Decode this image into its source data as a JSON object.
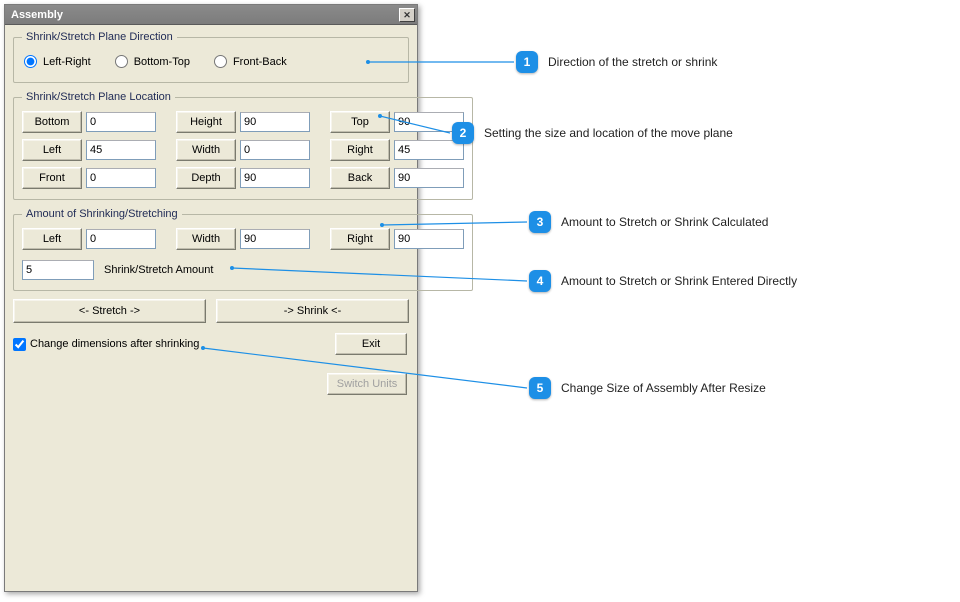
{
  "title": "Assembly",
  "direction": {
    "legend": "Shrink/Stretch Plane Direction",
    "options": {
      "lr": "Left-Right",
      "bt": "Bottom-Top",
      "fb": "Front-Back"
    },
    "selected": "lr"
  },
  "location": {
    "legend": "Shrink/Stretch Plane Location",
    "labels": {
      "bottom": "Bottom",
      "height": "Height",
      "top": "Top",
      "left": "Left",
      "width": "Width",
      "right": "Right",
      "front": "Front",
      "depth": "Depth",
      "back": "Back"
    },
    "values": {
      "bottom": "0",
      "height": "90",
      "top": "90",
      "left": "45",
      "width": "0",
      "right": "45",
      "front": "0",
      "depth": "90",
      "back": "90"
    }
  },
  "amount": {
    "legend": "Amount of Shrinking/Stretching",
    "labels": {
      "left": "Left",
      "width": "Width",
      "right": "Right",
      "shrinkAmt": "Shrink/Stretch Amount"
    },
    "values": {
      "left": "0",
      "width": "90",
      "right": "90",
      "shrinkAmt": "5"
    }
  },
  "buttons": {
    "stretch": "<-  Stretch  ->",
    "shrink": "->  Shrink  <-",
    "exit": "Exit",
    "switchUnits": "Switch Units"
  },
  "checkbox": {
    "label": "Change dimensions after shrinking",
    "checked": true
  },
  "callouts": {
    "1": "Direction of the stretch or shrink",
    "2": "Setting the size and location of the move plane",
    "3": "Amount to Stretch or Shrink Calculated",
    "4": "Amount to Stretch or Shrink Entered Directly",
    "5": "Change Size of Assembly After Resize"
  }
}
